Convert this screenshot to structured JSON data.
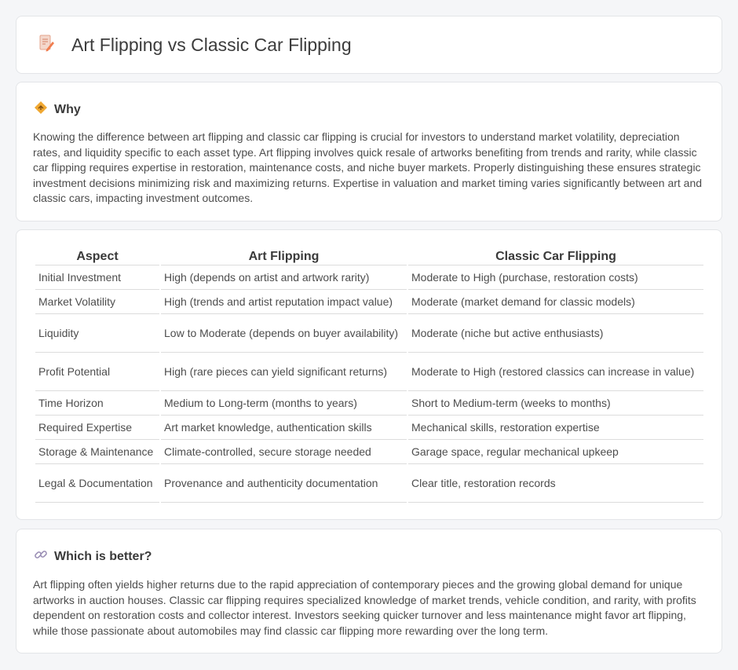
{
  "header": {
    "title": "Art Flipping vs Classic Car Flipping",
    "icon": "document-pencil-icon"
  },
  "why": {
    "icon": "diamond-sign-icon",
    "title": "Why",
    "text": "Knowing the difference between art flipping and classic car flipping is crucial for investors to understand market volatility, depreciation rates, and liquidity specific to each asset type. Art flipping involves quick resale of artworks benefiting from trends and rarity, while classic car flipping requires expertise in restoration, maintenance costs, and niche buyer markets. Properly distinguishing these ensures strategic investment decisions minimizing risk and maximizing returns. Expertise in valuation and market timing varies significantly between art and classic cars, impacting investment outcomes."
  },
  "table": {
    "headers": [
      "Aspect",
      "Art Flipping",
      "Classic Car Flipping"
    ],
    "rows": [
      [
        "Initial Investment",
        "High (depends on artist and artwork rarity)",
        "Moderate to High (purchase, restoration costs)"
      ],
      [
        "Market Volatility",
        "High (trends and artist reputation impact value)",
        "Moderate (market demand for classic models)"
      ],
      [
        "Liquidity",
        "Low to Moderate (depends on buyer availability)",
        "Moderate (niche but active enthusiasts)"
      ],
      [
        "Profit Potential",
        "High (rare pieces can yield significant returns)",
        "Moderate to High (restored classics can increase in value)"
      ],
      [
        "Time Horizon",
        "Medium to Long-term (months to years)",
        "Short to Medium-term (weeks to months)"
      ],
      [
        "Required Expertise",
        "Art market knowledge, authentication skills",
        "Mechanical skills, restoration expertise"
      ],
      [
        "Storage & Maintenance",
        "Climate-controlled, secure storage needed",
        "Garage space, regular mechanical upkeep"
      ],
      [
        "Legal & Documentation",
        "Provenance and authenticity documentation",
        "Clear title, restoration records"
      ]
    ]
  },
  "better": {
    "icon": "link-icon",
    "title": "Which is better?",
    "text": "Art flipping often yields higher returns due to the rapid appreciation of contemporary pieces and the growing global demand for unique artworks in auction houses. Classic car flipping requires specialized knowledge of market trends, vehicle condition, and rarity, with profits dependent on restoration costs and collector interest. Investors seeking quicker turnover and less maintenance might favor art flipping, while those passionate about automobiles may find classic car flipping more rewarding over the long term."
  },
  "colors": {
    "background": "#f5f6f8",
    "card": "#ffffff",
    "icon_accent": "#f08a5d",
    "diamond_icon": "#f0a832"
  }
}
